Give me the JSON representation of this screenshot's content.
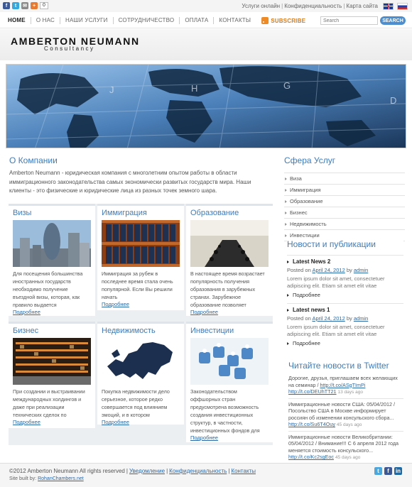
{
  "topbar": {
    "share_count": "0",
    "links": [
      "Услуги онлайн",
      "Конфиденциальность",
      "Карта сайта"
    ]
  },
  "nav": {
    "items": [
      "HOME",
      "О НАС",
      "НАШИ УСЛУГИ",
      "СОТРУДНИЧЕСТВО",
      "ОПЛАТА",
      "КОНТАКТЫ"
    ],
    "subscribe": "SUBSCRIBE",
    "search_placeholder": "Search",
    "search_button": "SEARCH"
  },
  "logo": {
    "main": "AMBERTON NEUMANN",
    "sub": "Consultancy"
  },
  "about": {
    "title": "О Компании",
    "text": "Amberton Neumann - юридическая компания с многолетним опытом работы в области иммиграционного законодательства самых экономически развитых государств мира. Наши клиенты - это физические и юридические лица из разных точек земного шара."
  },
  "cards": [
    {
      "title": "Визы",
      "text": "Для посещения большинства иностранных государств необходимо получение въездной визы, которая, как правило выдается",
      "more": "Подробнее"
    },
    {
      "title": "Иммиграция",
      "text": "Иммиграция за рубеж в последнее время стала очень популярной. Если Вы решили начать",
      "more": "Подробнее"
    },
    {
      "title": "Образование",
      "text": "В настоящее время возрастает популярность получения образования в зарубежных странах. Зарубежное образование позволяет",
      "more": "Подробнее"
    },
    {
      "title": "Бизнес",
      "text": "При создании и выстраивании международных холдингов и даже при реализации технических сделок по",
      "more": "Подробнее"
    },
    {
      "title": "Недвижимость",
      "text": "Покупка недвижимости дело серьезное, которое редко совершается под влиянием эмоций, и в котором",
      "more": "Подробнее"
    },
    {
      "title": "Инвестиции",
      "text": "Законодательством оффшорных стран предусмотрена возможность создания инвестиционных структур, в частности, инвестиционных фондов для",
      "more": "Подробнее"
    }
  ],
  "services": {
    "title": "Сфера Услуг",
    "items": [
      "Виза",
      "Иммиграция",
      "Образование",
      "Бизнес",
      "Недвижимость",
      "Инвестиции"
    ]
  },
  "news": {
    "title": "Новости и публикации",
    "items": [
      {
        "title": "Latest News 2",
        "posted": "Posted on",
        "date": "April 24, 2012",
        "by": "by",
        "author": "admin",
        "body": "Lorem ipsum dolor sit amet, consectetuer adipiscing elit. Etiam sit amet elit vitae",
        "more": "Подробнее"
      },
      {
        "title": "Latest news 1",
        "posted": "Posted on",
        "date": "April 24, 2012",
        "by": "by",
        "author": "admin",
        "body": "Lorem ipsum dolor sit amet, consectetuer adipiscing elit. Etiam sit amet elit vitae",
        "more": "Подробнее"
      }
    ]
  },
  "twitter": {
    "title": "Читайте новости в Twitter",
    "tweets": [
      {
        "text": "Дорогие, друзья, приглашаем всех желающих на семинар /",
        "link": "http://t.co/ASgTImPi",
        "link2": "http://t.co/DEUhTT21",
        "ago": "13 days ago"
      },
      {
        "text": "Иммиграционные новости США: 05/04/2012 / Посольство США в Москве информирует россиян об изменении консульского сбора...",
        "link": "http://t.co/Su6T4Ouy",
        "ago": "45 days ago"
      },
      {
        "text": "Иммиграционные новости Великобритании: 05/04/2012 / Внимание!!! С 6 апреля 2012 года меняется стоимость консульского...",
        "link": "http://t.co/Kc2sgEoc",
        "ago": "45 days ago"
      }
    ]
  },
  "footer": {
    "copyright": "©2012 Amberton Neumann All rights reserved",
    "links": [
      "Уведомление",
      "Конфиденциальность",
      "Контакты"
    ],
    "built_label": "Site built by:",
    "built_link": "RohanChambers.net"
  }
}
